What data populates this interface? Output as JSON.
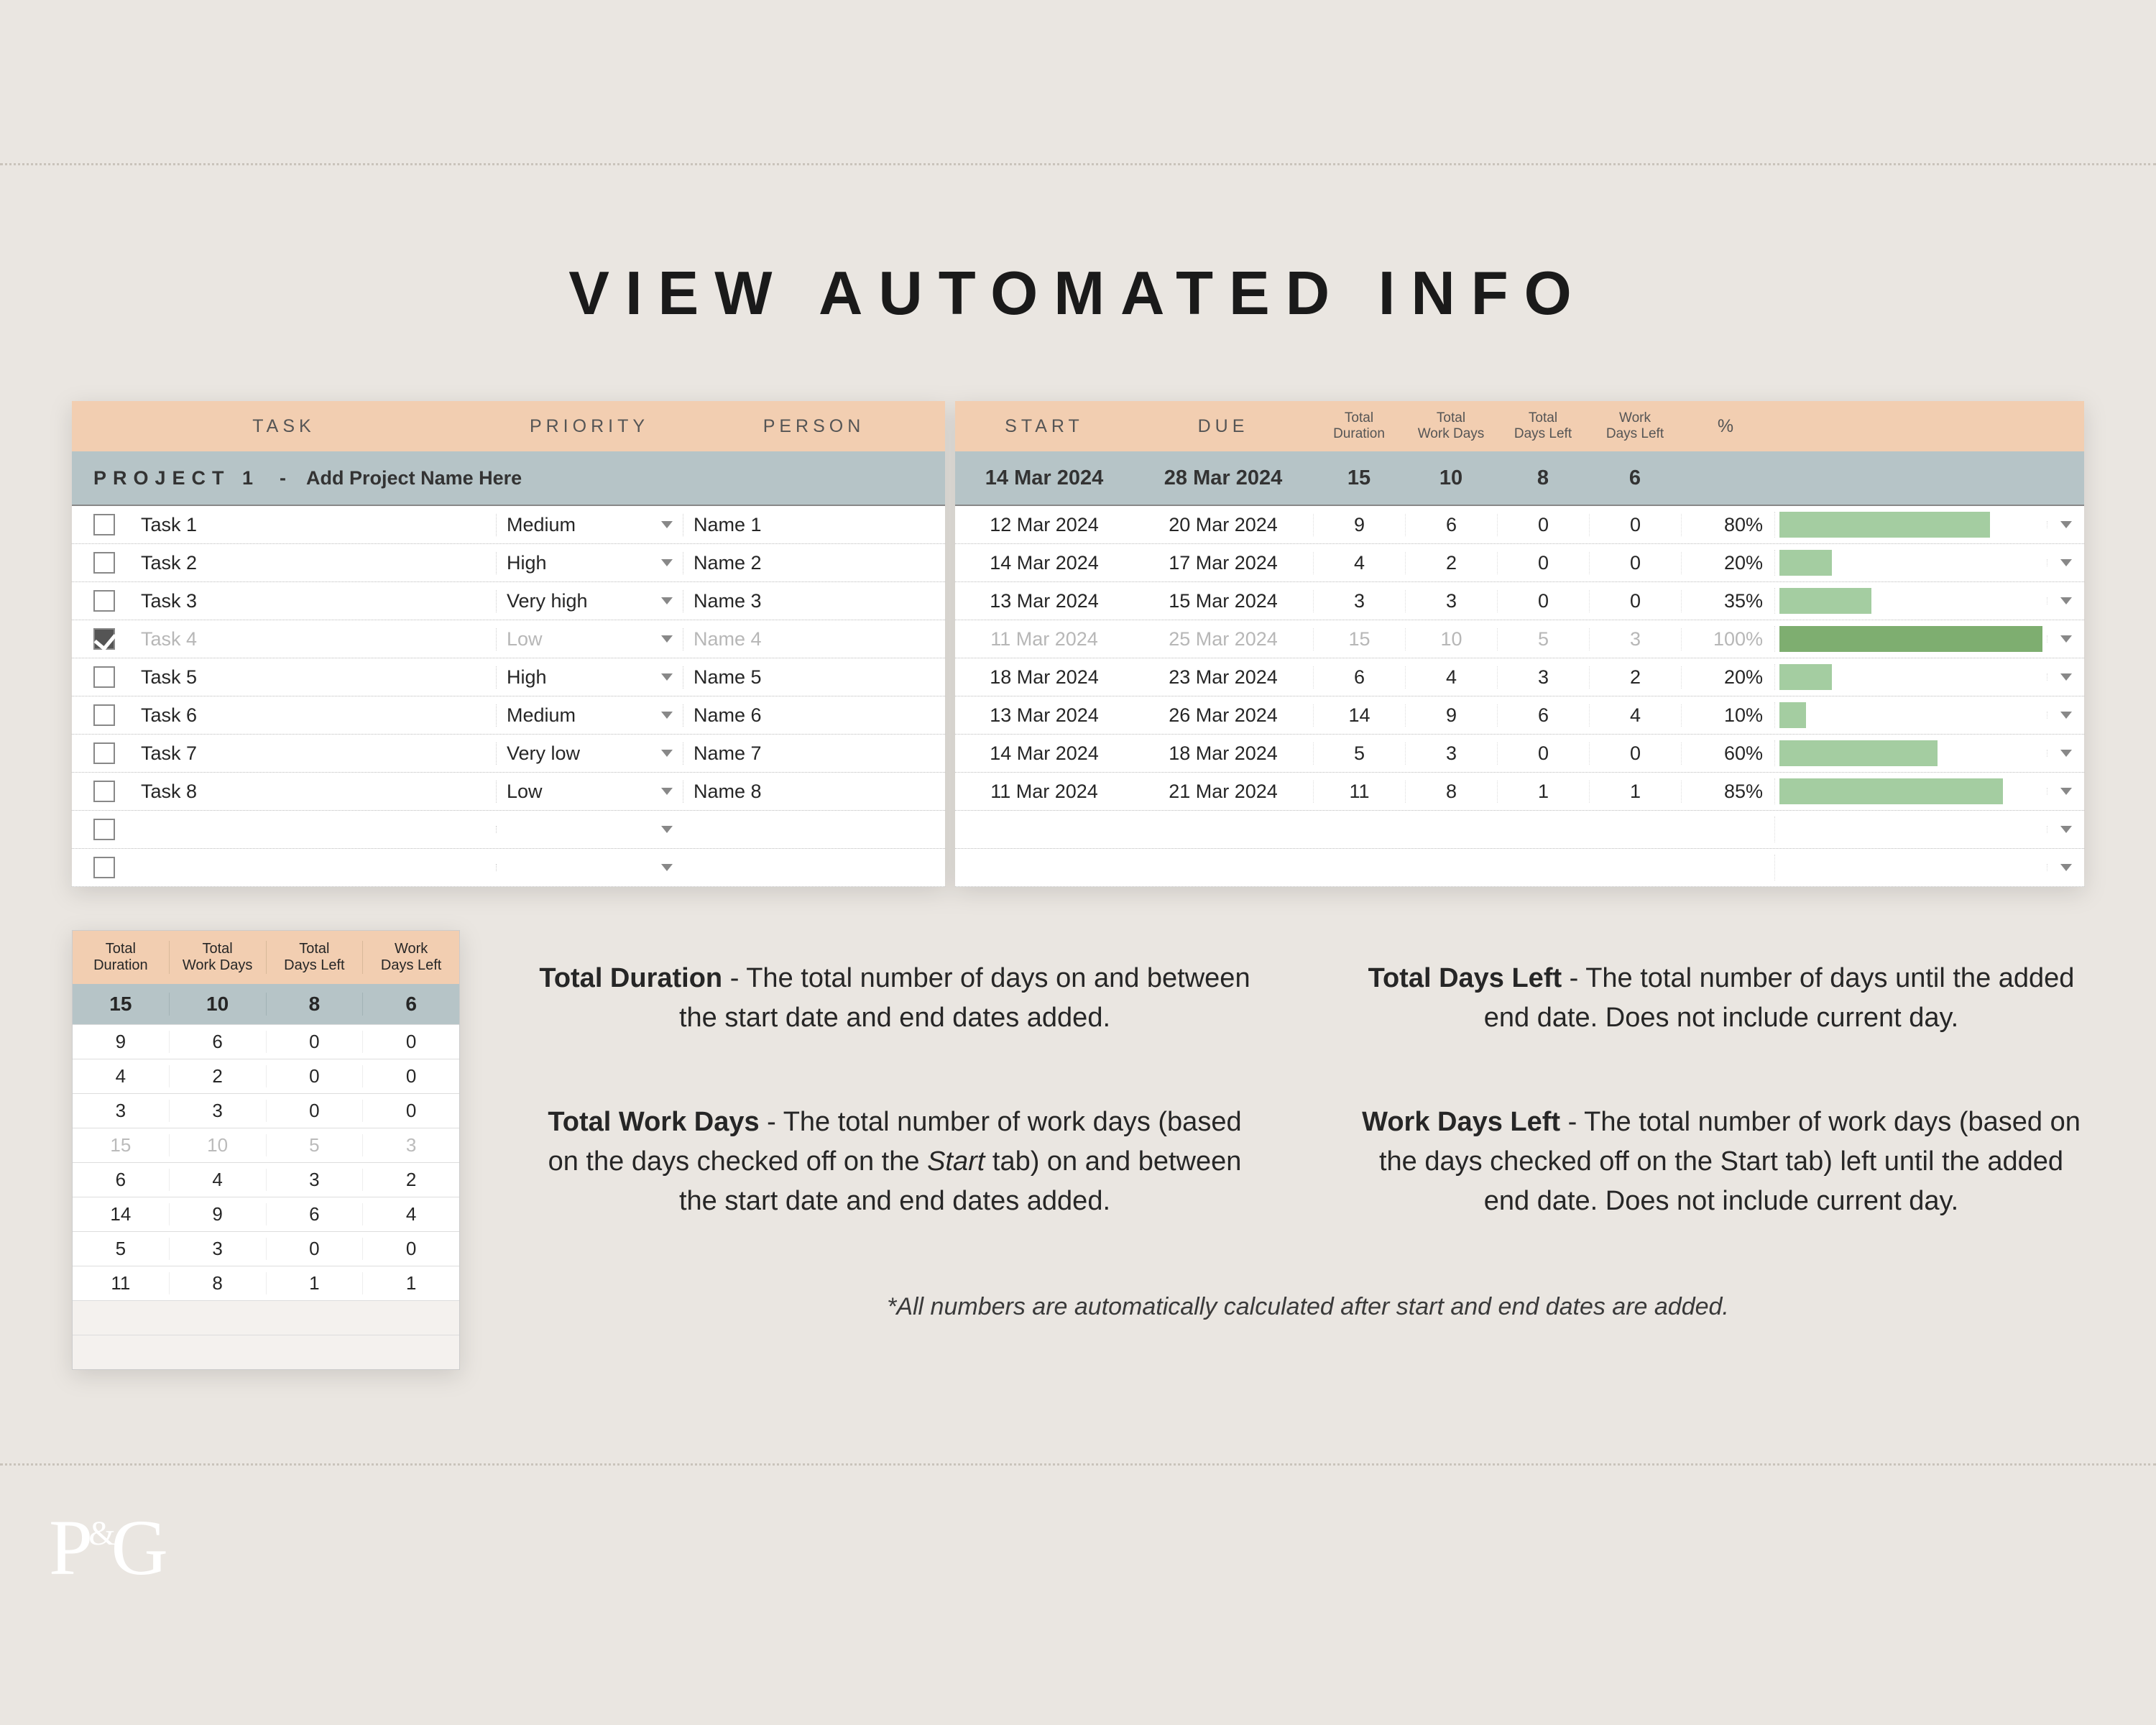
{
  "title": "VIEW AUTOMATED INFO",
  "headers_left": {
    "task": "TASK",
    "priority": "PRIORITY",
    "person": "PERSON"
  },
  "headers_right": {
    "start": "START",
    "due": "DUE",
    "tot_dur": "Total\nDuration",
    "tot_wd": "Total\nWork Days",
    "tot_dl": "Total\nDays Left",
    "wdl": "Work\nDays Left",
    "pct": "%"
  },
  "project_row": {
    "label": "PROJECT 1",
    "sep": "-",
    "sub": "Add Project Name Here",
    "start": "14 Mar 2024",
    "due": "28 Mar 2024",
    "tot_dur": "15",
    "tot_wd": "10",
    "tot_dl": "8",
    "wdl": "6"
  },
  "rows": [
    {
      "done": false,
      "task": "Task 1",
      "priority": "Medium",
      "person": "Name 1",
      "start": "12 Mar 2024",
      "due": "20 Mar 2024",
      "td": "9",
      "twd": "6",
      "tdl": "0",
      "wdl": "0",
      "pct": "80%",
      "bar": 80
    },
    {
      "done": false,
      "task": "Task 2",
      "priority": "High",
      "person": "Name 2",
      "start": "14 Mar 2024",
      "due": "17 Mar 2024",
      "td": "4",
      "twd": "2",
      "tdl": "0",
      "wdl": "0",
      "pct": "20%",
      "bar": 20
    },
    {
      "done": false,
      "task": "Task 3",
      "priority": "Very high",
      "person": "Name 3",
      "start": "13 Mar 2024",
      "due": "15 Mar 2024",
      "td": "3",
      "twd": "3",
      "tdl": "0",
      "wdl": "0",
      "pct": "35%",
      "bar": 35
    },
    {
      "done": true,
      "task": "Task 4",
      "priority": "Low",
      "person": "Name 4",
      "start": "11 Mar 2024",
      "due": "25 Mar 2024",
      "td": "15",
      "twd": "10",
      "tdl": "5",
      "wdl": "3",
      "pct": "100%",
      "bar": 100
    },
    {
      "done": false,
      "task": "Task 5",
      "priority": "High",
      "person": "Name 5",
      "start": "18 Mar 2024",
      "due": "23 Mar 2024",
      "td": "6",
      "twd": "4",
      "tdl": "3",
      "wdl": "2",
      "pct": "20%",
      "bar": 20
    },
    {
      "done": false,
      "task": "Task 6",
      "priority": "Medium",
      "person": "Name 6",
      "start": "13 Mar 2024",
      "due": "26 Mar 2024",
      "td": "14",
      "twd": "9",
      "tdl": "6",
      "wdl": "4",
      "pct": "10%",
      "bar": 10
    },
    {
      "done": false,
      "task": "Task 7",
      "priority": "Very low",
      "person": "Name 7",
      "start": "14 Mar 2024",
      "due": "18 Mar 2024",
      "td": "5",
      "twd": "3",
      "tdl": "0",
      "wdl": "0",
      "pct": "60%",
      "bar": 60
    },
    {
      "done": false,
      "task": "Task 8",
      "priority": "Low",
      "person": "Name 8",
      "start": "11 Mar 2024",
      "due": "21 Mar 2024",
      "td": "11",
      "twd": "8",
      "tdl": "1",
      "wdl": "1",
      "pct": "85%",
      "bar": 85
    },
    {
      "done": false,
      "task": "",
      "priority": "",
      "person": "",
      "start": "",
      "due": "",
      "td": "",
      "twd": "",
      "tdl": "",
      "wdl": "",
      "pct": "",
      "bar": 0
    },
    {
      "done": false,
      "task": "",
      "priority": "",
      "person": "",
      "start": "",
      "due": "",
      "td": "",
      "twd": "",
      "tdl": "",
      "wdl": "",
      "pct": "",
      "bar": 0
    }
  ],
  "mini_headers": {
    "td": "Total\nDuration",
    "twd": "Total\nWork Days",
    "tdl": "Total\nDays Left",
    "wdl": "Work\nDays Left"
  },
  "mini_summary": {
    "td": "15",
    "twd": "10",
    "tdl": "8",
    "wdl": "6"
  },
  "mini_rows": [
    {
      "td": "9",
      "twd": "6",
      "tdl": "0",
      "wdl": "0",
      "faded": false
    },
    {
      "td": "4",
      "twd": "2",
      "tdl": "0",
      "wdl": "0",
      "faded": false
    },
    {
      "td": "3",
      "twd": "3",
      "tdl": "0",
      "wdl": "0",
      "faded": false
    },
    {
      "td": "15",
      "twd": "10",
      "tdl": "5",
      "wdl": "3",
      "faded": true
    },
    {
      "td": "6",
      "twd": "4",
      "tdl": "3",
      "wdl": "2",
      "faded": false
    },
    {
      "td": "14",
      "twd": "9",
      "tdl": "6",
      "wdl": "4",
      "faded": false
    },
    {
      "td": "5",
      "twd": "3",
      "tdl": "0",
      "wdl": "0",
      "faded": false
    },
    {
      "td": "11",
      "twd": "8",
      "tdl": "1",
      "wdl": "1",
      "faded": false
    },
    {
      "td": "",
      "twd": "",
      "tdl": "",
      "wdl": "",
      "faded": false,
      "empty": true
    },
    {
      "td": "",
      "twd": "",
      "tdl": "",
      "wdl": "",
      "faded": false,
      "empty": true
    }
  ],
  "explain": {
    "td_t": "Total Duration",
    "td_b": " - The total number of days on and between the start date and end dates added.",
    "tdl_t": "Total Days Left",
    "tdl_b": " - The total number of days until the added end date. Does not include current day.",
    "twd_t": "Total Work Days",
    "twd_b": " - The total number of work days (based on the days checked off on the ",
    "twd_i": "Start",
    "twd_b2": " tab) on and between the start date and end dates added.",
    "wdl_t": "Work Days Left",
    "wdl_b": " - The total number of work days (based on the days checked off on the Start tab) left until the added end date. Does not include current day."
  },
  "footnote": "*All numbers are automatically calculated after start and end dates are added.",
  "logo": {
    "p": "P",
    "amp": "&",
    "g": "G"
  }
}
